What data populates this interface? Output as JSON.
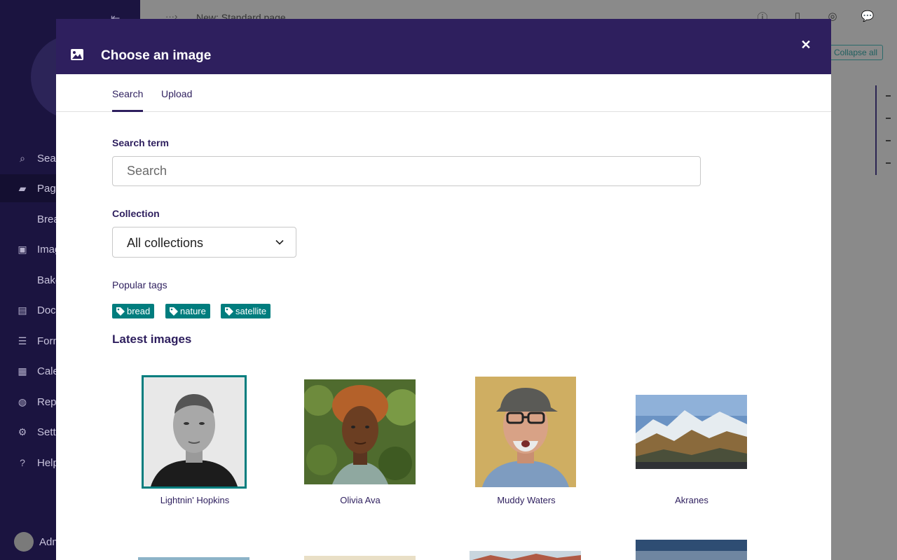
{
  "background": {
    "page_title": "New: Standard page",
    "collapse_all_label": "Collapse all",
    "sidebar_items": [
      {
        "label": "Sea",
        "icon": "search-icon"
      },
      {
        "label": "Page",
        "icon": "folder-open-icon"
      },
      {
        "label": "Brea",
        "icon": ""
      },
      {
        "label": "Imag",
        "icon": "image-icon"
      },
      {
        "label": "Bake",
        "icon": ""
      },
      {
        "label": "Docu",
        "icon": "document-icon"
      },
      {
        "label": "Form",
        "icon": "list-icon"
      },
      {
        "label": "Cale",
        "icon": "calendar-icon"
      },
      {
        "label": "Repo",
        "icon": "globe-icon"
      },
      {
        "label": "Setti",
        "icon": "cogs-icon"
      },
      {
        "label": "Help",
        "icon": "help-icon"
      }
    ],
    "account_label": "Adm"
  },
  "modal": {
    "title": "Choose an image",
    "tabs": [
      {
        "label": "Search",
        "active": true
      },
      {
        "label": "Upload",
        "active": false
      }
    ],
    "search": {
      "label": "Search term",
      "placeholder": "Search",
      "value": ""
    },
    "collection": {
      "label": "Collection",
      "selected": "All collections"
    },
    "popular_tags_label": "Popular tags",
    "tags": [
      "bread",
      "nature",
      "satellite"
    ],
    "latest_images_title": "Latest images",
    "images": [
      {
        "title": "Lightnin' Hopkins",
        "selected": true
      },
      {
        "title": "Olivia Ava",
        "selected": false
      },
      {
        "title": "Muddy Waters",
        "selected": false
      },
      {
        "title": "Akranes",
        "selected": false
      }
    ]
  },
  "colors": {
    "header_bg": "#2e1f5e",
    "accent_teal": "#007d7e",
    "sidebar_bg": "#1b1440"
  }
}
